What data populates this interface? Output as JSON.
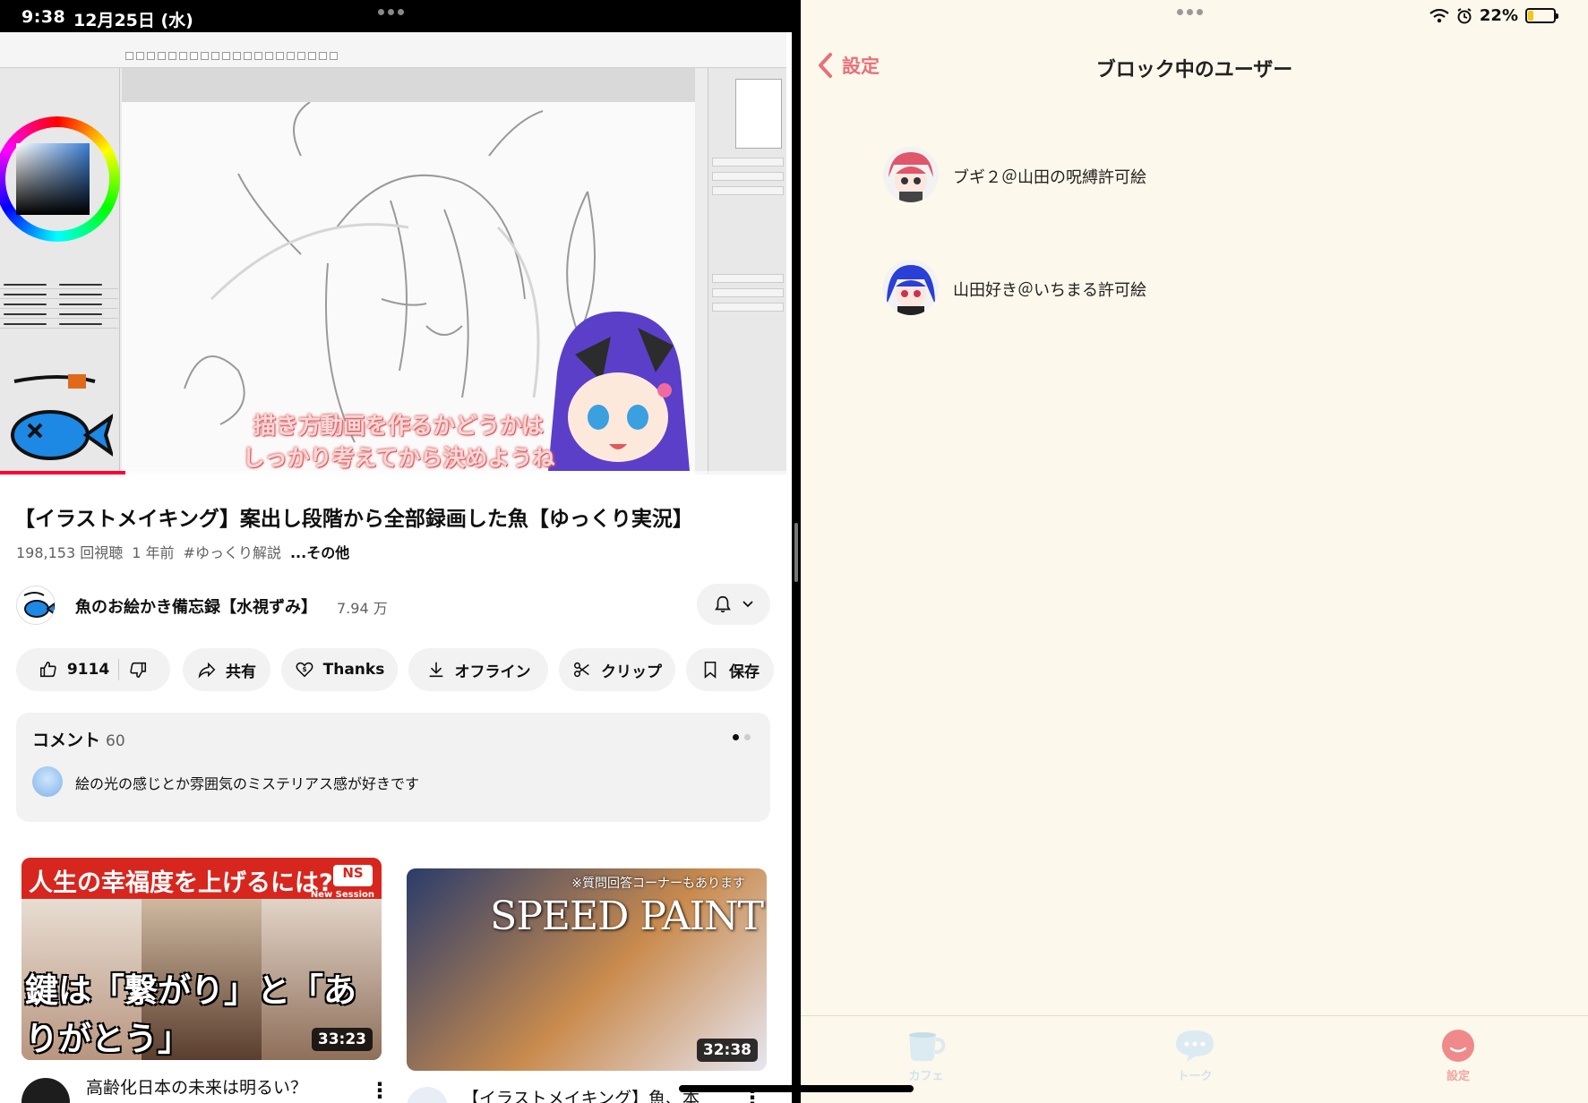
{
  "status_left": {
    "time": "9:38",
    "date": "12月25日 (水)"
  },
  "status_right": {
    "battery_percent": "22%",
    "battery_level": 0.22
  },
  "player": {
    "subtitle_line1": "描き方動画を作るかどうかは",
    "subtitle_line2": "しっかり考えてから決めようね",
    "progress": 0.16,
    "progress_color": "#ff0033"
  },
  "video": {
    "title": "【イラストメイキング】案出し段階から全部録画した魚【ゆっくり実況】",
    "views": "198,153 回視聴",
    "age": "1 年前",
    "hashtag": "#ゆっくり解説",
    "more": "...その他"
  },
  "channel": {
    "name": "魚のお絵かき備忘録【水視ずみ】",
    "subscribers": "7.94 万"
  },
  "actions": {
    "like_count": "9114",
    "share": "共有",
    "thanks": "Thanks",
    "offline": "オフライン",
    "clip": "クリップ",
    "save": "保存"
  },
  "comments": {
    "header": "コメント",
    "count": "60",
    "top_comment": "絵の光の感じとか雰囲気のミステリアス感が好きです"
  },
  "related": [
    {
      "banner": "人生の幸福度を上げるには?",
      "badge": "NS",
      "badge_sub": "New Session",
      "bottom_text": "鍵は「繋がり」と「ありがとう」",
      "duration": "33:23",
      "title": "高齢化日本の未来は明るい？"
    },
    {
      "qa": "※質問回答コーナーもあります",
      "speed": "SPEED PAINT",
      "duration": "32:38",
      "title": "【イラストメイキング】魚、本"
    }
  ],
  "settings": {
    "back_label": "設定",
    "title": "ブロック中のユーザー",
    "users": [
      {
        "name": "ブギ２＠山田の呪縛許可絵"
      },
      {
        "name": "山田好き＠いちまる許可絵"
      }
    ]
  },
  "tabs": [
    {
      "label": "カフェ",
      "icon": "cup-icon"
    },
    {
      "label": "トーク",
      "icon": "chat-bubble-icon"
    },
    {
      "label": "設定",
      "icon": "face-icon"
    }
  ],
  "colors": {
    "accent_pink": "#e8707a",
    "bg_cream": "#fdf8ec",
    "like_red": "#ff0033"
  }
}
